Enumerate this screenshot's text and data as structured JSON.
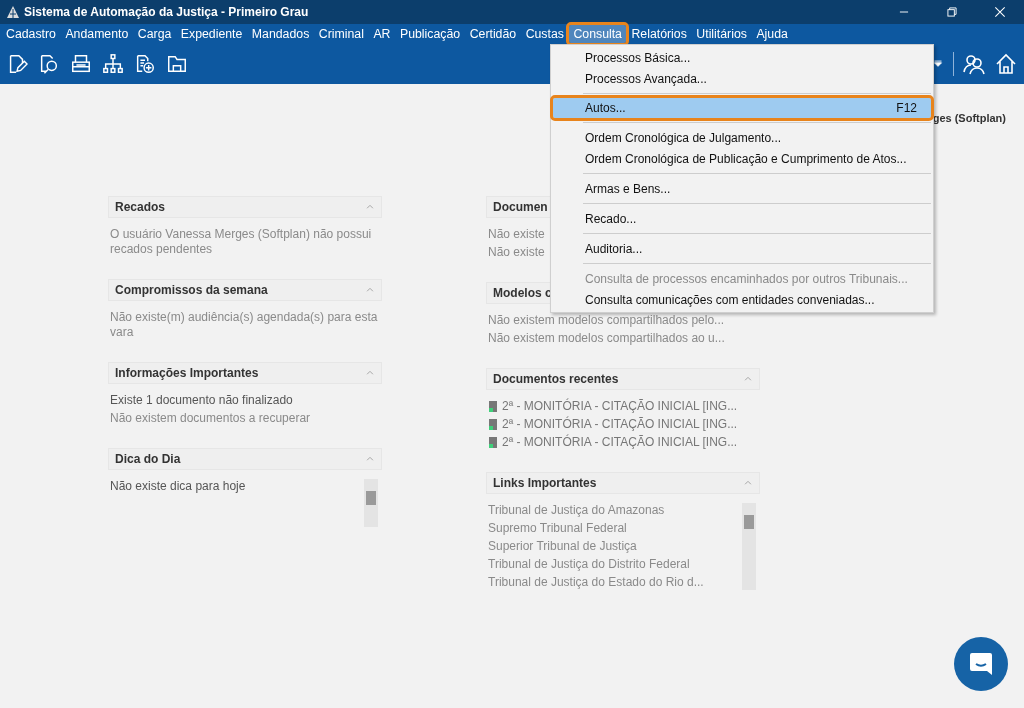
{
  "window": {
    "title": "Sistema de Automação da Justiça - Primeiro Grau"
  },
  "menu_bar": [
    {
      "label": "Cadastro",
      "selected": false
    },
    {
      "label": "Andamento",
      "selected": false
    },
    {
      "label": "Carga",
      "selected": false
    },
    {
      "label": "Expediente",
      "selected": false
    },
    {
      "label": "Mandados",
      "selected": false
    },
    {
      "label": "Criminal",
      "selected": false
    },
    {
      "label": "AR",
      "selected": false
    },
    {
      "label": "Publicação",
      "selected": false
    },
    {
      "label": "Certidão",
      "selected": false
    },
    {
      "label": "Custas",
      "selected": false
    },
    {
      "label": "Consulta",
      "selected": true
    },
    {
      "label": "Relatórios",
      "selected": false
    },
    {
      "label": "Utilitários",
      "selected": false
    },
    {
      "label": "Ajuda",
      "selected": false
    }
  ],
  "dropdown": {
    "items": [
      {
        "kind": "item",
        "label": "Processos Básica...",
        "selected": false,
        "disabled": false
      },
      {
        "kind": "item",
        "label": "Processos Avançada...",
        "selected": false,
        "disabled": false
      },
      {
        "kind": "separator"
      },
      {
        "kind": "item",
        "label": "Autos...",
        "shortcut": "F12",
        "selected": true,
        "disabled": false
      },
      {
        "kind": "separator"
      },
      {
        "kind": "item",
        "label": "Ordem Cronológica de Julgamento...",
        "selected": false,
        "disabled": false
      },
      {
        "kind": "item",
        "label": "Ordem Cronológica de Publicação e Cumprimento de Atos...",
        "selected": false,
        "disabled": false
      },
      {
        "kind": "separator"
      },
      {
        "kind": "item",
        "label": "Armas e Bens...",
        "selected": false,
        "disabled": false
      },
      {
        "kind": "separator"
      },
      {
        "kind": "item",
        "label": "Recado...",
        "selected": false,
        "disabled": false
      },
      {
        "kind": "separator"
      },
      {
        "kind": "item",
        "label": "Auditoria...",
        "selected": false,
        "disabled": false
      },
      {
        "kind": "separator"
      },
      {
        "kind": "item",
        "label": "Consulta de processos encaminhados por outros Tribunais...",
        "selected": false,
        "disabled": true
      },
      {
        "kind": "item",
        "label": "Consulta comunicações com entidades conveniadas...",
        "selected": false,
        "disabled": false
      }
    ]
  },
  "user_label": "ges (Softplan)",
  "left_panels": [
    {
      "title": "Recados",
      "collapse_icon": true,
      "lines": [
        {
          "text": "O usuário Vanessa Merges (Softplan) não possui recados pendentes",
          "kind": "muted"
        }
      ]
    },
    {
      "title": "Compromissos da semana",
      "collapse_icon": true,
      "lines": [
        {
          "text": "Não existe(m) audiência(s) agendada(s) para esta vara",
          "kind": "muted"
        }
      ]
    },
    {
      "title": "Informações Importantes",
      "collapse_icon": true,
      "lines": [
        {
          "text": "Existe 1 documento não finalizado",
          "kind": "normal"
        },
        {
          "text": "Não existem documentos a recuperar",
          "kind": "muted"
        }
      ]
    },
    {
      "title": "Dica do Dia",
      "collapse_icon": true,
      "scrollbar": true,
      "lines": [
        {
          "text": "Não existe dica para hoje",
          "kind": "normal"
        }
      ]
    }
  ],
  "right_panels": [
    {
      "title": "Documen",
      "lines": [
        {
          "text": "Não existe",
          "kind": "muted"
        },
        {
          "text": "Não existe",
          "kind": "muted"
        }
      ]
    },
    {
      "title": "Modelos c",
      "lines": [
        {
          "text": "Não existem modelos compartilhados pelo...",
          "kind": "muted"
        },
        {
          "text": "Não existem modelos compartilhados ao u...",
          "kind": "muted"
        }
      ]
    },
    {
      "title": "Documentos recentes",
      "collapse_icon": true,
      "lines": [
        {
          "text": "2ª - MONITÓRIA - CITAÇÃO INICIAL [ING...",
          "kind": "document"
        },
        {
          "text": "2ª - MONITÓRIA - CITAÇÃO INICIAL [ING...",
          "kind": "document"
        },
        {
          "text": "2ª - MONITÓRIA - CITAÇÃO INICIAL [ING...",
          "kind": "document"
        }
      ]
    },
    {
      "title": "Links Importantes",
      "collapse_icon": true,
      "scrollbar": true,
      "lines": [
        {
          "text": "Tribunal de Justiça do Amazonas",
          "kind": "muted"
        },
        {
          "text": "Supremo Tribunal Federal",
          "kind": "muted"
        },
        {
          "text": "Superior Tribunal de Justiça",
          "kind": "muted"
        },
        {
          "text": "Tribunal de Justiça do Distrito Federal",
          "kind": "muted"
        },
        {
          "text": "Tribunal de Justiça do Estado do Rio d...",
          "kind": "muted"
        }
      ]
    }
  ]
}
